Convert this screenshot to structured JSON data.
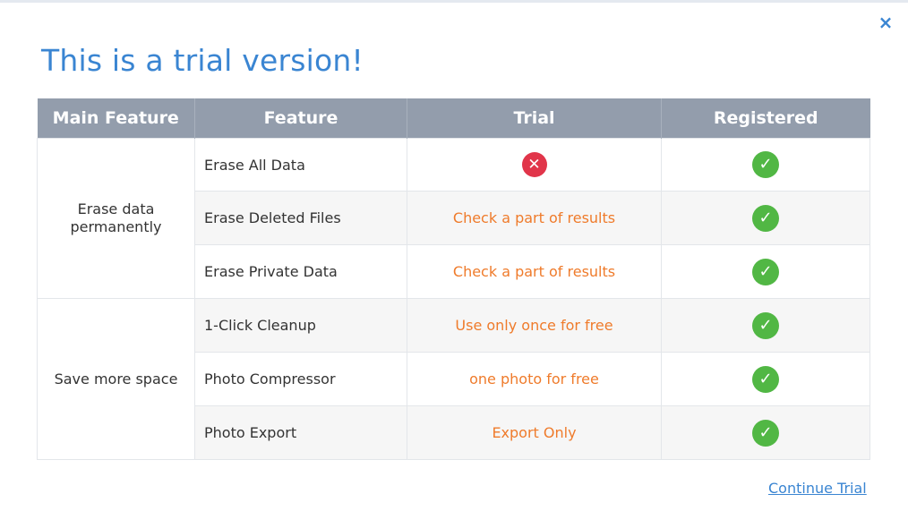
{
  "dialog": {
    "title": "This is a trial version!",
    "close_glyph": "×",
    "continue_label": "Continue Trial"
  },
  "table": {
    "headers": [
      "Main Feature",
      "Feature",
      "Trial",
      "Registered"
    ],
    "groups": [
      {
        "main": "Erase data permanently",
        "rows": [
          {
            "feature": "Erase All Data",
            "trial": "",
            "trial_icon": "x-circle-icon",
            "registered_icon": "check-circle-icon"
          },
          {
            "feature": "Erase Deleted Files",
            "trial": "Check a part of results",
            "registered_icon": "check-circle-icon"
          },
          {
            "feature": "Erase Private Data",
            "trial": "Check a part of results",
            "registered_icon": "check-circle-icon"
          }
        ]
      },
      {
        "main": "Save more space",
        "rows": [
          {
            "feature": "1-Click Cleanup",
            "trial": "Use only once for free",
            "registered_icon": "check-circle-icon"
          },
          {
            "feature": "Photo Compressor",
            "trial": "one photo for free",
            "registered_icon": "check-circle-icon"
          },
          {
            "feature": "Photo Export",
            "trial": "Export Only",
            "registered_icon": "check-circle-icon"
          }
        ]
      }
    ]
  },
  "icons": {
    "check_glyph": "✓",
    "x_glyph": "✕"
  },
  "colors": {
    "accent": "#3a85d2",
    "header_bg": "#939dac",
    "trial_text": "#ef7b2b",
    "check": "#51b744",
    "cross": "#e1354a"
  }
}
